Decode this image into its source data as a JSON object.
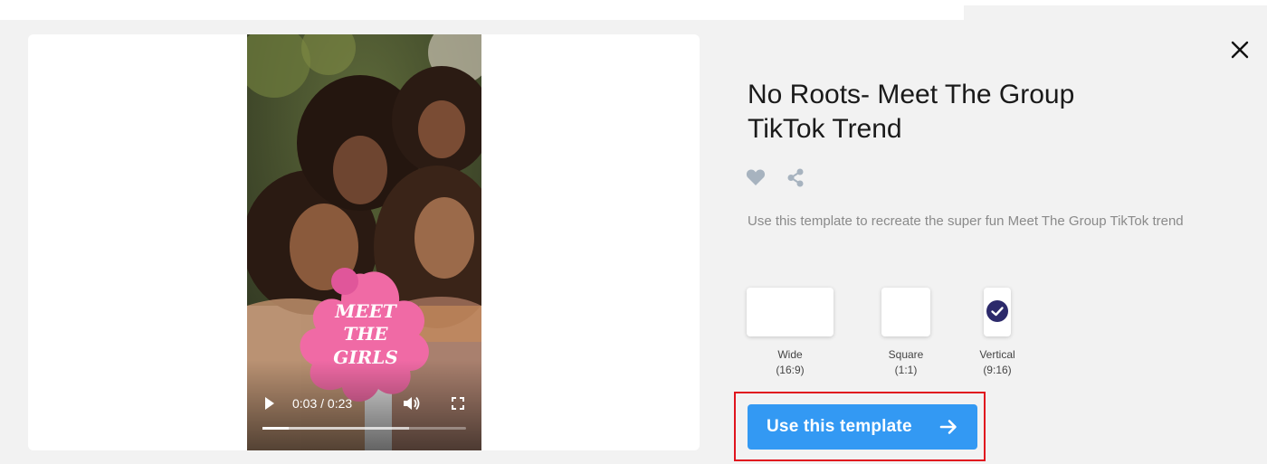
{
  "template": {
    "title_line1": "No Roots- Meet The Group",
    "title_line2": "TikTok Trend",
    "description": "Use this template to recreate the super fun Meet The Group TikTok trend"
  },
  "video": {
    "time_display": "0:03 / 0:23",
    "progress_played": 0.13,
    "progress_buffered": 0.72,
    "sticker_lines": [
      "MEET",
      "THE",
      "GIRLS"
    ],
    "sticker_color": "#f06aa5"
  },
  "formats": [
    {
      "name": "Wide",
      "ratio": "(16:9)",
      "selected": false
    },
    {
      "name": "Square",
      "ratio": "(1:1)",
      "selected": false
    },
    {
      "name": "Vertical",
      "ratio": "(9:16)",
      "selected": true
    }
  ],
  "cta": {
    "label": "Use this template"
  },
  "colors": {
    "accent": "#3399f3",
    "selected_check": "#2c2a6b",
    "highlight_border": "#e0141e",
    "icon_gray": "#a7b3bf"
  },
  "icons": {
    "close": "close-icon",
    "favorite": "heart-icon",
    "share": "share-icon",
    "play": "play-icon",
    "volume": "volume-icon",
    "fullscreen": "fullscreen-icon",
    "cta_arrow": "arrow-right-icon",
    "selected": "check-icon"
  }
}
